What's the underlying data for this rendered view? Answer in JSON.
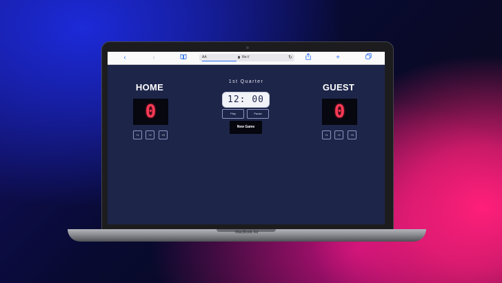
{
  "device": {
    "model_label": "MacBook Air"
  },
  "browser": {
    "aa_label": "AA",
    "url": "file://",
    "icons": {
      "back": "chevron-left-icon",
      "forward": "chevron-right-icon",
      "bookmarks": "book-icon",
      "lock": "lock-icon",
      "reload": "reload-icon",
      "share": "share-icon",
      "new_tab": "plus-icon",
      "tabs": "tabs-icon"
    }
  },
  "scoreboard": {
    "home": {
      "title": "HOME",
      "score": "0",
      "buttons": [
        "+1",
        "+2",
        "+3"
      ]
    },
    "guest": {
      "title": "GUEST",
      "score": "0",
      "buttons": [
        "+1",
        "+2",
        "+3"
      ]
    },
    "period": "1st Quarter",
    "timer": "12: 00",
    "play_label": "Play",
    "pause_label": "Pause",
    "new_game_label": "New Game",
    "colors": {
      "background": "#1d2549",
      "score_digit": "#ff3a55",
      "score_box": "#06070f"
    }
  }
}
